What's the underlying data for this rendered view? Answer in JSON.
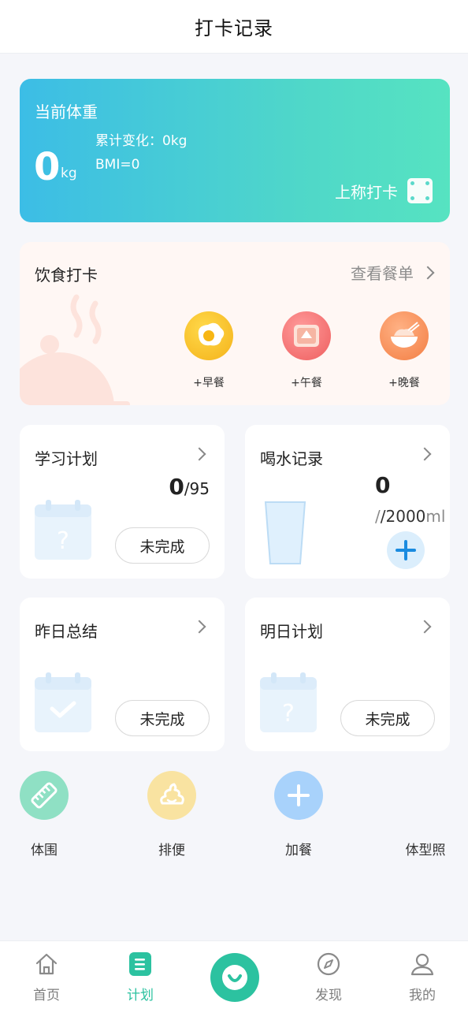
{
  "header": {
    "title": "打卡记录"
  },
  "weight": {
    "label": "当前体重",
    "value": "0",
    "unit": "kg",
    "change": "累计变化：0kg",
    "bmi": "BMI=0",
    "scale_label": "上称打卡"
  },
  "diet": {
    "title": "饮食打卡",
    "menu_link": "查看餐单",
    "meals": [
      {
        "label": "+早餐",
        "icon": "fried-egg-icon",
        "color": "#fbc325"
      },
      {
        "label": "+午餐",
        "icon": "lunch-box-icon",
        "color": "#f57474"
      },
      {
        "label": "+晚餐",
        "icon": "dinner-bowl-icon",
        "color": "#f78c55"
      }
    ]
  },
  "study": {
    "title": "学习计划",
    "done": "0",
    "total": "/95",
    "status": "未完成"
  },
  "water": {
    "title": "喝水记录",
    "amount": "0",
    "goal": "/2000",
    "unit": "ml"
  },
  "yesterday": {
    "title": "昨日总结",
    "status": "未完成"
  },
  "tomorrow": {
    "title": "明日计划",
    "status": "未完成"
  },
  "quick_actions": [
    {
      "label": "体围",
      "icon": "ruler-icon",
      "color": "#8fe0c4"
    },
    {
      "label": "排便",
      "icon": "poop-icon",
      "color": "#f9e3a1"
    },
    {
      "label": "加餐",
      "icon": "plus-icon",
      "color": "#a8d2fb"
    },
    {
      "label": "体型照",
      "icon": "camera-icon",
      "color": ""
    }
  ],
  "tabs": [
    {
      "label": "首页",
      "icon": "home-icon"
    },
    {
      "label": "计划",
      "icon": "plan-icon"
    },
    {
      "label": "",
      "icon": "smile-icon"
    },
    {
      "label": "发现",
      "icon": "compass-icon"
    },
    {
      "label": "我的",
      "icon": "user-icon"
    }
  ],
  "accent_color": "#2cc2a0"
}
